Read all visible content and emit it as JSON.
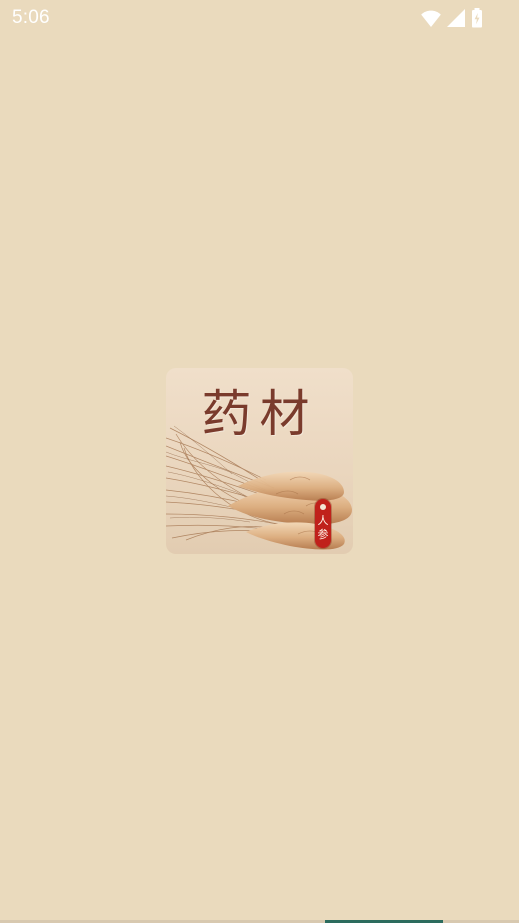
{
  "status_bar": {
    "time": "5:06",
    "icons": [
      "wifi-icon",
      "signal-icon",
      "battery-charging-icon"
    ],
    "color": "#ffffff"
  },
  "splash": {
    "logo_title": "药材",
    "logo_tag": "人参",
    "background_color": "#eadabd",
    "title_color": "#7a3b2c",
    "tag_color": "#c0211b"
  }
}
